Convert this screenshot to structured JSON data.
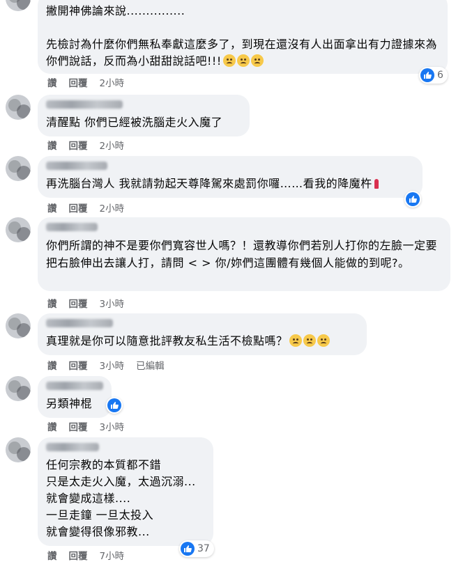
{
  "actions": {
    "like": "讚",
    "reply": "回覆",
    "edited": "已編輯"
  },
  "comments": [
    {
      "text": "撇開神佛論來說...............\n\n先檢討為什麼你們無私奉獻這麼多了，到現在還沒有人出面拿出有力證據來為你們說話，反而為小甜甜說話吧!!!",
      "emoji_count": 3,
      "time": "2小時",
      "reactions": "6"
    },
    {
      "text": "清醒點 你們已經被洗腦走火入魔了",
      "time": "2小時"
    },
    {
      "text": "再洗腦台灣人 我就請勃起天尊降駕來處罰你囉……看我的降魔杵",
      "time": "2小時"
    },
    {
      "text": "你們所謂的神不是要你們寬容世人嗎？！還教導你們若別人打你的左臉一定要把右臉伸出去讓人打，請問 < > 你/妳們這團體有幾個人能做的到呢?。",
      "time": "3小時"
    },
    {
      "text": "真理就是你可以隨意批評教友私生活不檢點嗎？",
      "emoji_count": 3,
      "time": "3小時"
    },
    {
      "text": "另類神棍",
      "time": "3小時"
    },
    {
      "text": "任何宗教的本質都不錯\n只是太走火入魔，太過沉溺...\n就會變成這樣....\n一旦走鐘 一旦太投入\n就會變得很像邪教...",
      "time": "7小時",
      "reactions": "37"
    }
  ],
  "colors": {
    "bubble": "#f0f2f5",
    "meta": "#65676b",
    "like_blue": "#1877f2"
  }
}
